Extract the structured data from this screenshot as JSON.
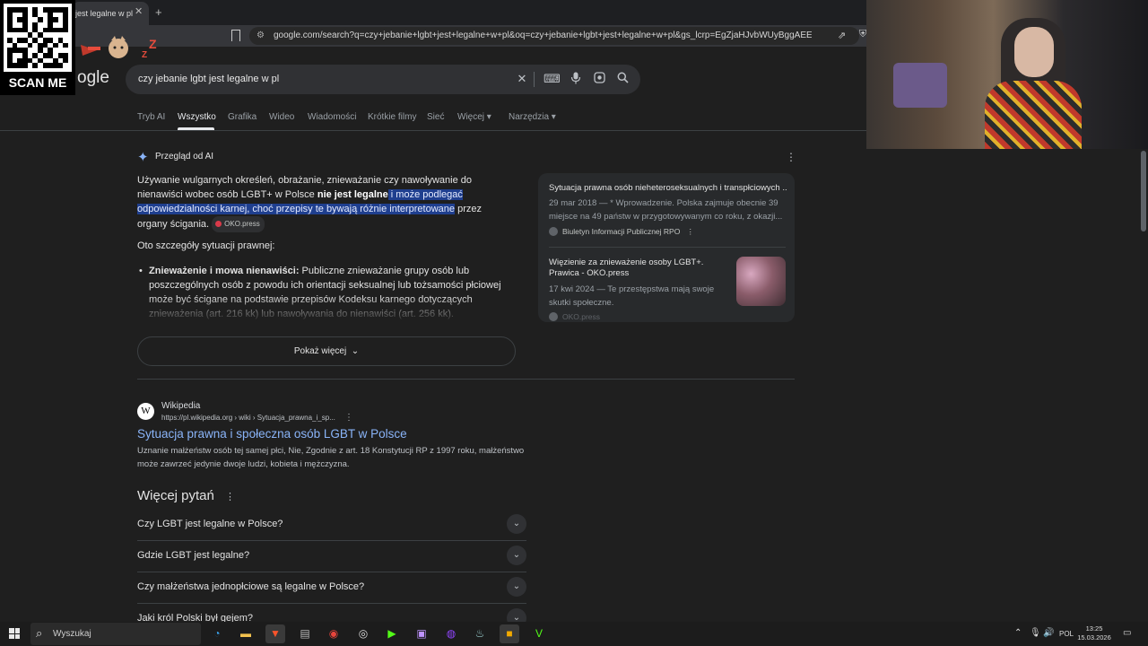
{
  "browser": {
    "tab_title": "jest legalne w pl",
    "tab_close": "✕",
    "new_tab": "+",
    "url": "google.com/search?q=czy+jebanie+lgbt+jest+legalne+w+pl&oq=czy+jebanie+lgbt+jest+legalne+w+pl&gs_lcrp=EgZjaHJvbWUyBggAEEUYOTIGCA..."
  },
  "overlay": {
    "qr_label": "SCAN ME"
  },
  "google": {
    "logo_partial": "ogle",
    "query": "czy jebanie lgbt jest legalne w pl",
    "nav": [
      "Tryb AI",
      "Wszystko",
      "Grafika",
      "Wideo",
      "Wiadomości",
      "Krótkie filmy",
      "Sieć",
      "Więcej",
      "Narzędzia"
    ],
    "active_nav": "Wszystko"
  },
  "ai_overview": {
    "title": "Przegląd od AI",
    "para_a": "Używanie wulgarnych określeń, obrażanie, znieważanie czy nawoływanie do nienawiści wobec osób LGBT+ w Polsce ",
    "para_bold": "nie jest legalne",
    "para_hl": " i może podlegać odpowiedzialności karnej, choć przepisy te bywają różnie interpretowane",
    "para_c": " przez organy ścigania.",
    "chip": "OKO.press",
    "subheading": "Oto szczegóły sytuacji prawnej:",
    "bullet_bold": "Znieważenie i mowa nienawiści:",
    "bullet_text": " Publiczne znieważanie grupy osób lub poszczególnych osób z powodu ich orientacji seksualnej lub tożsamości płciowej może być ścigane na podstawie przepisów Kodeksu karnego dotyczących znieważenia (art. 216 kk) lub nawoływania do nienawiści (art. 256 kk).",
    "show_more": "Pokaż więcej"
  },
  "sources": [
    {
      "title": "Sytuacja prawna osób nieheteroseksualnych i transpłciowych ...",
      "snippet": "29 mar 2018 — * Wprowadzenie. Polska zajmuje obecnie 39 miejsce na 49 państw w przygotowywanym co roku, z okazji...",
      "site": "Biuletyn Informacji Publicznej RPO"
    },
    {
      "title": "Więzienie za znieważenie osoby LGBT+. Prawica - OKO.press",
      "snippet": "17 kwi 2024 — Te przestępstwa mają swoje skutki społeczne.",
      "site": "OKO.press"
    }
  ],
  "result": {
    "site": "Wikipedia",
    "url": "https://pl.wikipedia.org › wiki › Sytuacja_prawna_i_sp...",
    "title": "Sytuacja prawna i społeczna osób LGBT w Polsce",
    "snippet": "Uznanie małżeństw osób tej samej płci, Nie, Zgodnie z art. 18 Konstytucji RP z 1997 roku, małżeństwo może zawrzeć jedynie dwoje ludzi, kobieta i mężczyzna."
  },
  "paa": {
    "title": "Więcej pytań",
    "questions": [
      "Czy LGBT jest legalne w Polsce?",
      "Gdzie LGBT jest legalne?",
      "Czy małżeństwa jednopłciowe są legalne w Polsce?",
      "Jaki król Polski był gejem?"
    ]
  },
  "taskbar": {
    "search_label": "Wyszukaj",
    "lang": "POL",
    "time": "13:25",
    "date": "15.03.2026"
  },
  "colors": {
    "link": "#8ab4f8",
    "highlight": "#1f3f8f",
    "background": "#1f1f1f"
  }
}
